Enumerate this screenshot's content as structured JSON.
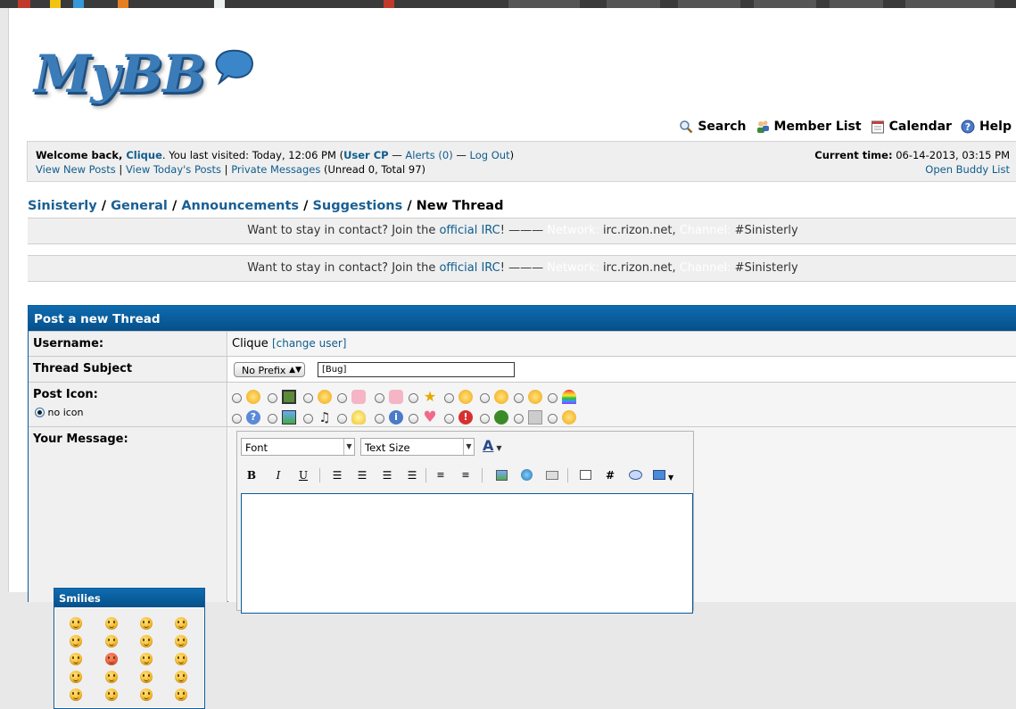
{
  "logo": {
    "text": "MyBB"
  },
  "header_links": [
    {
      "label": "Search",
      "icon": "magnifier-icon"
    },
    {
      "label": "Member List",
      "icon": "members-icon"
    },
    {
      "label": "Calendar",
      "icon": "calendar-icon"
    },
    {
      "label": "Help",
      "icon": "help-icon"
    }
  ],
  "welcome": {
    "prefix": "Welcome back, ",
    "username": "Clique",
    "visited": ". You last visited: Today, 12:06 PM (",
    "user_cp": "User CP",
    "dash1": " — ",
    "alerts": "Alerts (0)",
    "dash2": " — ",
    "logout": "Log Out",
    "close": ")",
    "view_new": "View New Posts",
    "sep1": " | ",
    "view_today": "View Today's Posts",
    "sep2": " | ",
    "pm": "Private Messages",
    "pm_counts": " (Unread 0, Total 97)",
    "time_label": "Current time:",
    "time_value": " 06-14-2013, 03:15 PM",
    "buddy": "Open Buddy List"
  },
  "breadcrumb": {
    "items": [
      "Sinisterly",
      "General",
      "Announcements",
      "Suggestions"
    ],
    "sep": " / ",
    "current": "New Thread"
  },
  "banner": {
    "text1": "Want to stay in contact? Join the ",
    "link": "official IRC",
    "text2": "! ——— ",
    "network_label": "Network:",
    "network_value": " irc.rizon.net, ",
    "channel_label": "Channel:",
    "channel_value": " #Sinisterly"
  },
  "form": {
    "title": "Post a new Thread",
    "username_label": "Username:",
    "username_value": "Clique",
    "change_user": "[change user]",
    "subject_label": "Thread Subject",
    "prefix_select": "No Prefix",
    "subject_value": "[Bug]",
    "post_icon_label": "Post Icon:",
    "no_icon_label": "no icon",
    "message_label": "Your Message:"
  },
  "editor": {
    "font_select": "Font",
    "size_select": "Text Size"
  },
  "smilies": {
    "title": "Smilies"
  },
  "colors": {
    "accent": "#0b5c9a",
    "link": "#0f5c8e",
    "panel": "#efefef"
  }
}
